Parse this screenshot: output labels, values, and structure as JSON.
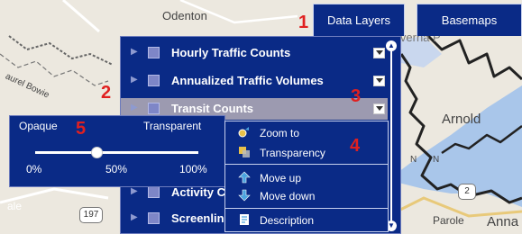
{
  "toolbar": {
    "data_layers_label": "Data Layers",
    "basemaps_label": "Basemaps"
  },
  "map": {
    "labels": {
      "odenton": "Odenton",
      "severna_park": "Severna P",
      "laurel_bowie": "aurel Bowie",
      "arnold": "Arnold",
      "parole": "Parole",
      "annapolis": "Anna",
      "ale": "ale",
      "compass_n1": "N",
      "compass_n2": "N"
    },
    "shields": {
      "route_197": "197",
      "route_2": "2"
    }
  },
  "layers": [
    {
      "label": "Hourly Traffic Counts"
    },
    {
      "label": "Annualized Traffic Volumes"
    },
    {
      "label": "Transit Counts",
      "selected": true
    },
    {
      "label": "Activity C"
    },
    {
      "label": "Screenlin"
    }
  ],
  "opacity_popup": {
    "opaque_label": "Opaque",
    "transparent_label": "Transparent",
    "ticks": [
      "0%",
      "50%",
      "100%"
    ],
    "value_percent": 38
  },
  "context_menu": {
    "zoom_to": "Zoom to",
    "transparency": "Transparency",
    "move_up": "Move up",
    "move_down": "Move down",
    "description": "Description"
  },
  "callouts": {
    "c1": "1",
    "c2": "2",
    "c3": "3",
    "c4": "4",
    "c5": "5"
  },
  "icons": {
    "zoom": "zoom-to-icon",
    "transparency": "transparency-icon",
    "up": "move-up-arrow-icon",
    "down": "move-down-arrow-icon",
    "description": "description-icon"
  },
  "colors": {
    "panel": "#0a2a86",
    "selected_row": "#9c9ab0",
    "callout": "#e02020",
    "water": "#a9c6ea"
  }
}
